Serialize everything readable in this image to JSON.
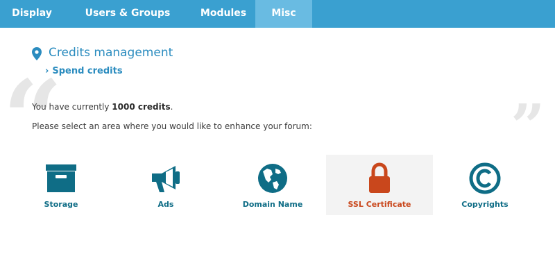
{
  "nav": {
    "tabs": [
      {
        "label": "Display",
        "active": false
      },
      {
        "label": "Users & Groups",
        "active": false
      },
      {
        "label": "Modules",
        "active": false
      },
      {
        "label": "Misc",
        "active": true
      }
    ]
  },
  "section": {
    "title": "Credits management",
    "subtitle": "Spend credits",
    "icon": "location-pin-icon"
  },
  "credits": {
    "prefix": "You have currently ",
    "amount": "1000 credits",
    "suffix": ".",
    "instruction": "Please select an area where you would like to enhance your forum:"
  },
  "options": [
    {
      "label": "Storage",
      "icon": "box-icon",
      "selected": false
    },
    {
      "label": "Ads",
      "icon": "megaphone-icon",
      "selected": false
    },
    {
      "label": "Domain Name",
      "icon": "globe-icon",
      "selected": false
    },
    {
      "label": "SSL Certificate",
      "icon": "lock-icon",
      "selected": true
    },
    {
      "label": "Copyrights",
      "icon": "copyright-icon",
      "selected": false
    }
  ],
  "colors": {
    "nav_bg": "#3aa0d0",
    "nav_active": "#69bbe2",
    "teal": "#0f6d86",
    "accent": "#2b8cbf",
    "ssl": "#c9471c"
  }
}
